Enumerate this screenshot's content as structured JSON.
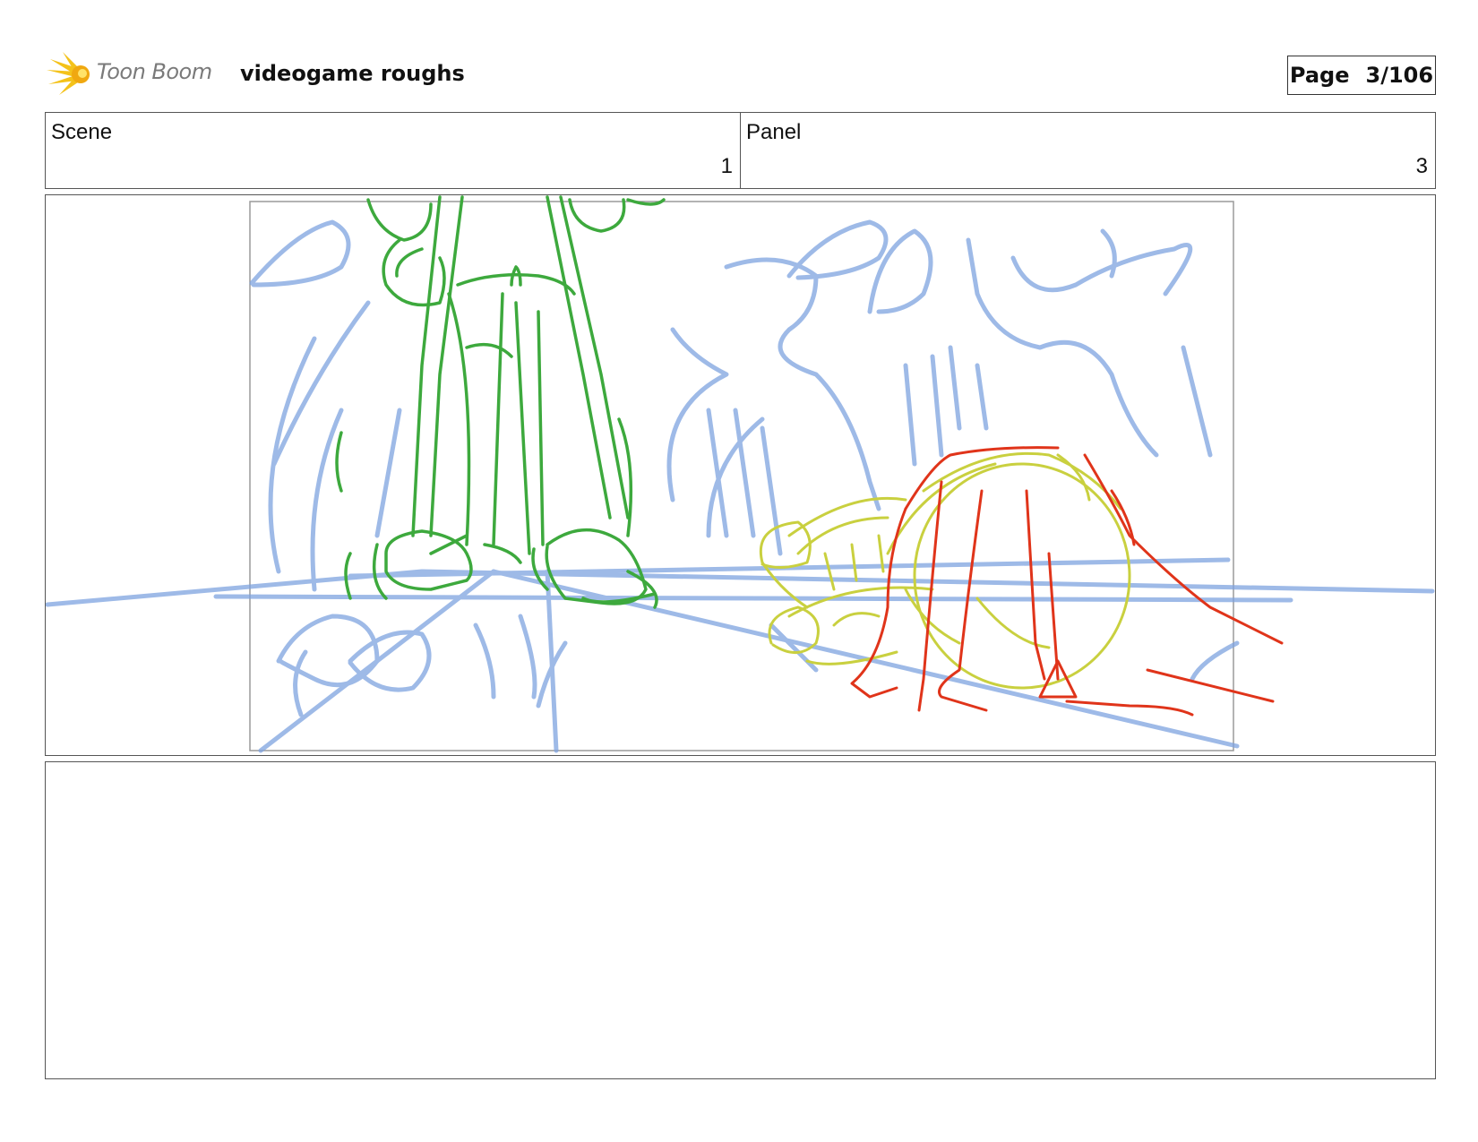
{
  "header": {
    "logo_text": "Toon Boom",
    "document_title": "videogame roughs",
    "page_label": "Page",
    "page_number": "3/106"
  },
  "scene": {
    "label": "Scene",
    "value": "1"
  },
  "panel": {
    "label": "Panel",
    "value": "3"
  },
  "sketch": {
    "colors": {
      "background_lines": "#7ea3e0",
      "character_left": "#3da93d",
      "character_right_outline": "#c9d03f",
      "character_right_overlay": "#e0341a",
      "camera_frame": "#9a9a9a"
    }
  },
  "notes": {
    "text": ""
  }
}
